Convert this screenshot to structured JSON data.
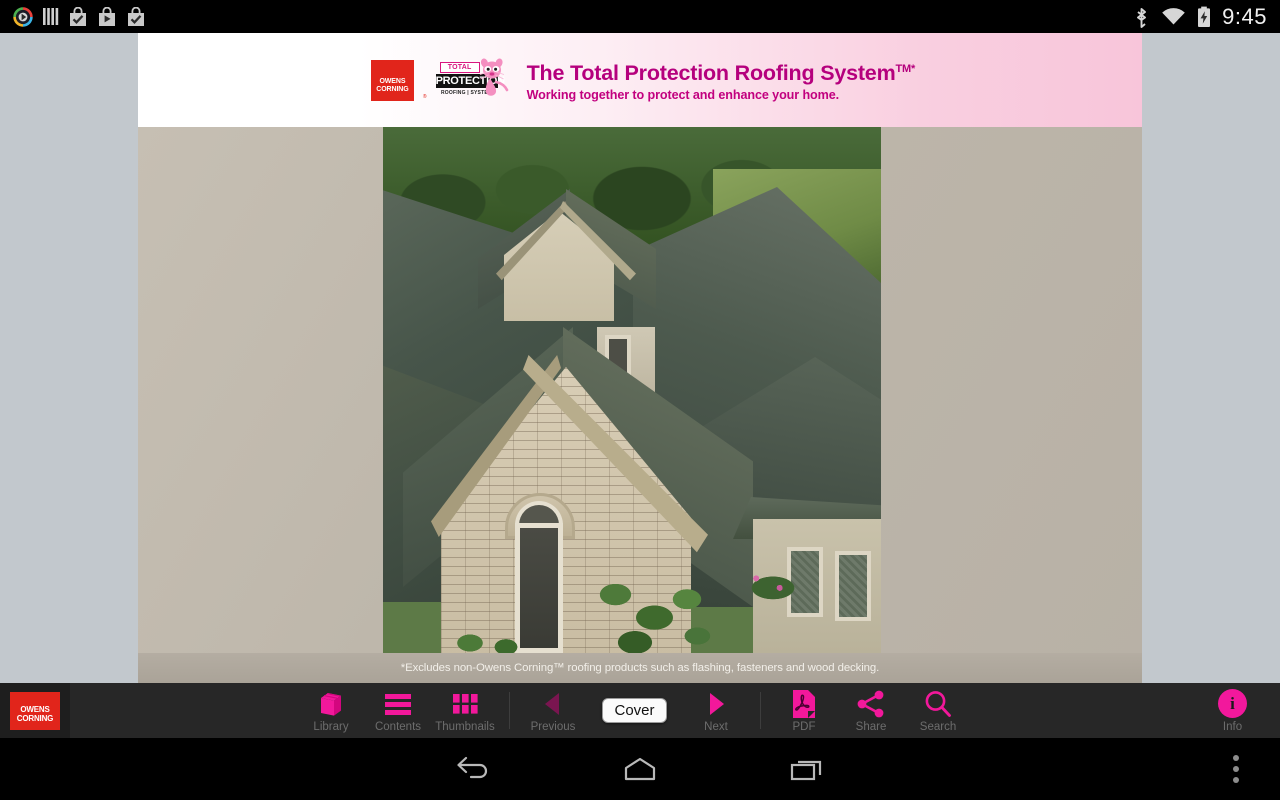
{
  "status_bar": {
    "time": "9:45",
    "left_icons": [
      {
        "name": "app-notification-icon",
        "label": "recorder"
      },
      {
        "name": "columns-notification-icon",
        "label": "columns"
      },
      {
        "name": "download-complete-icon",
        "label": "download-check"
      },
      {
        "name": "download-play-icon",
        "label": "download-play"
      },
      {
        "name": "download-complete-icon-2",
        "label": "download-check"
      }
    ],
    "right_icons": [
      {
        "name": "bluetooth-icon",
        "label": "Bluetooth"
      },
      {
        "name": "wifi-icon",
        "label": "Wi-Fi"
      },
      {
        "name": "battery-charging-icon",
        "label": "Battery charging"
      }
    ]
  },
  "page": {
    "header": {
      "brand_logo_line1": "OWENS",
      "brand_logo_line2": "CORNING",
      "registered_mark": "®",
      "badge_total": "TOTAL",
      "badge_protection": "PROTECTION",
      "badge_subtitle": "ROOFING | SYSTEM",
      "title": "The Total Protection Roofing System",
      "title_mark": "TM*",
      "subtitle": "Working together to protect and enhance your home."
    },
    "footnote": "*Excludes non-Owens Corning™ roofing products such as flashing, fasteners and wood decking."
  },
  "toolbar": {
    "logo_line1": "OWENS",
    "logo_line2": "CORNING",
    "items": [
      {
        "name": "library",
        "label": "Library",
        "icon": "books-icon",
        "enabled": true
      },
      {
        "name": "contents",
        "label": "Contents",
        "icon": "list-lines-icon",
        "enabled": true
      },
      {
        "name": "thumbnails",
        "label": "Thumbnails",
        "icon": "grid-icon",
        "enabled": true
      }
    ],
    "nav": {
      "previous_label": "Previous",
      "previous_icon": "triangle-left-icon",
      "previous_enabled": false,
      "next_label": "Next",
      "next_icon": "triangle-right-icon",
      "next_enabled": true,
      "page_value": "Cover"
    },
    "actions": [
      {
        "name": "pdf",
        "label": "PDF",
        "icon": "pdf-file-icon",
        "enabled": true
      },
      {
        "name": "share",
        "label": "Share",
        "icon": "share-nodes-icon",
        "enabled": true
      },
      {
        "name": "search",
        "label": "Search",
        "icon": "magnifier-icon",
        "enabled": true
      }
    ],
    "info": {
      "label": "Info",
      "icon": "info-circle-icon",
      "glyph": "i"
    }
  },
  "nav_bar": {
    "back_label": "Back",
    "home_label": "Home",
    "recents_label": "Recent apps",
    "more_label": "More options"
  },
  "colors": {
    "accent_pink": "#f2189b",
    "accent_pink_dim": "#7a1550",
    "brand_red": "#e1251b",
    "header_magenta": "#b5007d",
    "viewer_bg": "#c2c8cd",
    "toolbar_bg": "#272727"
  }
}
